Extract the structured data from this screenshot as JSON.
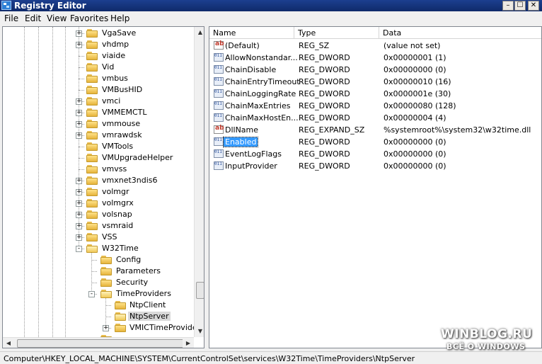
{
  "window": {
    "title": "Registry Editor",
    "controls": [
      "minimize",
      "maximize",
      "close"
    ]
  },
  "menu": [
    "File",
    "Edit",
    "View",
    "Favorites",
    "Help"
  ],
  "tree": {
    "items": [
      {
        "label": "VgaSave",
        "expander": "+",
        "level": 0
      },
      {
        "label": "vhdmp",
        "expander": "+",
        "level": 0
      },
      {
        "label": "viaide",
        "expander": "",
        "level": 0
      },
      {
        "label": "Vid",
        "expander": "",
        "level": 0
      },
      {
        "label": "vmbus",
        "expander": "",
        "level": 0
      },
      {
        "label": "VMBusHID",
        "expander": "",
        "level": 0
      },
      {
        "label": "vmci",
        "expander": "+",
        "level": 0
      },
      {
        "label": "VMMEMCTL",
        "expander": "+",
        "level": 0
      },
      {
        "label": "vmmouse",
        "expander": "+",
        "level": 0
      },
      {
        "label": "vmrawdsk",
        "expander": "+",
        "level": 0
      },
      {
        "label": "VMTools",
        "expander": "",
        "level": 0
      },
      {
        "label": "VMUpgradeHelper",
        "expander": "",
        "level": 0
      },
      {
        "label": "vmvss",
        "expander": "",
        "level": 0
      },
      {
        "label": "vmxnet3ndis6",
        "expander": "+",
        "level": 0
      },
      {
        "label": "volmgr",
        "expander": "+",
        "level": 0
      },
      {
        "label": "volmgrx",
        "expander": "+",
        "level": 0
      },
      {
        "label": "volsnap",
        "expander": "+",
        "level": 0
      },
      {
        "label": "vsmraid",
        "expander": "+",
        "level": 0
      },
      {
        "label": "VSS",
        "expander": "+",
        "level": 0
      },
      {
        "label": "W32Time",
        "expander": "-",
        "level": 0
      },
      {
        "label": "Config",
        "expander": "",
        "level": 1
      },
      {
        "label": "Parameters",
        "expander": "",
        "level": 1
      },
      {
        "label": "Security",
        "expander": "",
        "level": 1
      },
      {
        "label": "TimeProviders",
        "expander": "-",
        "level": 1
      },
      {
        "label": "NtpClient",
        "expander": "",
        "level": 2
      },
      {
        "label": "NtpServer",
        "expander": "",
        "level": 2,
        "selected": true
      },
      {
        "label": "VMICTimeProvider",
        "expander": "+",
        "level": 2
      }
    ]
  },
  "values": {
    "headers": [
      "Name",
      "Type",
      "Data"
    ],
    "rows": [
      {
        "icon": "string-value-icon",
        "kind": "sz",
        "name": "(Default)",
        "type": "REG_SZ",
        "data": "(value not set)"
      },
      {
        "icon": "binary-value-icon",
        "kind": "dw",
        "name": "AllowNonstandar...",
        "type": "REG_DWORD",
        "data": "0x00000001 (1)"
      },
      {
        "icon": "binary-value-icon",
        "kind": "dw",
        "name": "ChainDisable",
        "type": "REG_DWORD",
        "data": "0x00000000 (0)"
      },
      {
        "icon": "binary-value-icon",
        "kind": "dw",
        "name": "ChainEntryTimeout",
        "type": "REG_DWORD",
        "data": "0x00000010 (16)"
      },
      {
        "icon": "binary-value-icon",
        "kind": "dw",
        "name": "ChainLoggingRate",
        "type": "REG_DWORD",
        "data": "0x0000001e (30)"
      },
      {
        "icon": "binary-value-icon",
        "kind": "dw",
        "name": "ChainMaxEntries",
        "type": "REG_DWORD",
        "data": "0x00000080 (128)"
      },
      {
        "icon": "binary-value-icon",
        "kind": "dw",
        "name": "ChainMaxHostEn...",
        "type": "REG_DWORD",
        "data": "0x00000004 (4)"
      },
      {
        "icon": "string-value-icon",
        "kind": "sz",
        "name": "DllName",
        "type": "REG_EXPAND_SZ",
        "data": "%systemroot%\\system32\\w32time.dll"
      },
      {
        "icon": "binary-value-icon",
        "kind": "dw",
        "name": "Enabled",
        "type": "REG_DWORD",
        "data": "0x00000000 (0)",
        "selected": true
      },
      {
        "icon": "binary-value-icon",
        "kind": "dw",
        "name": "EventLogFlags",
        "type": "REG_DWORD",
        "data": "0x00000000 (0)"
      },
      {
        "icon": "binary-value-icon",
        "kind": "dw",
        "name": "InputProvider",
        "type": "REG_DWORD",
        "data": "0x00000000 (0)"
      }
    ]
  },
  "statusbar": {
    "path": "Computer\\HKEY_LOCAL_MACHINE\\SYSTEM\\CurrentControlSet\\services\\W32Time\\TimeProviders\\NtpServer"
  },
  "watermark": {
    "line1": "WINBLOG.RU",
    "line2": "ВСЁ О WINDOWS"
  },
  "colors": {
    "titlebar": "#1c3f8f",
    "selection": "#3399ff",
    "folder": "#f0c95a"
  }
}
